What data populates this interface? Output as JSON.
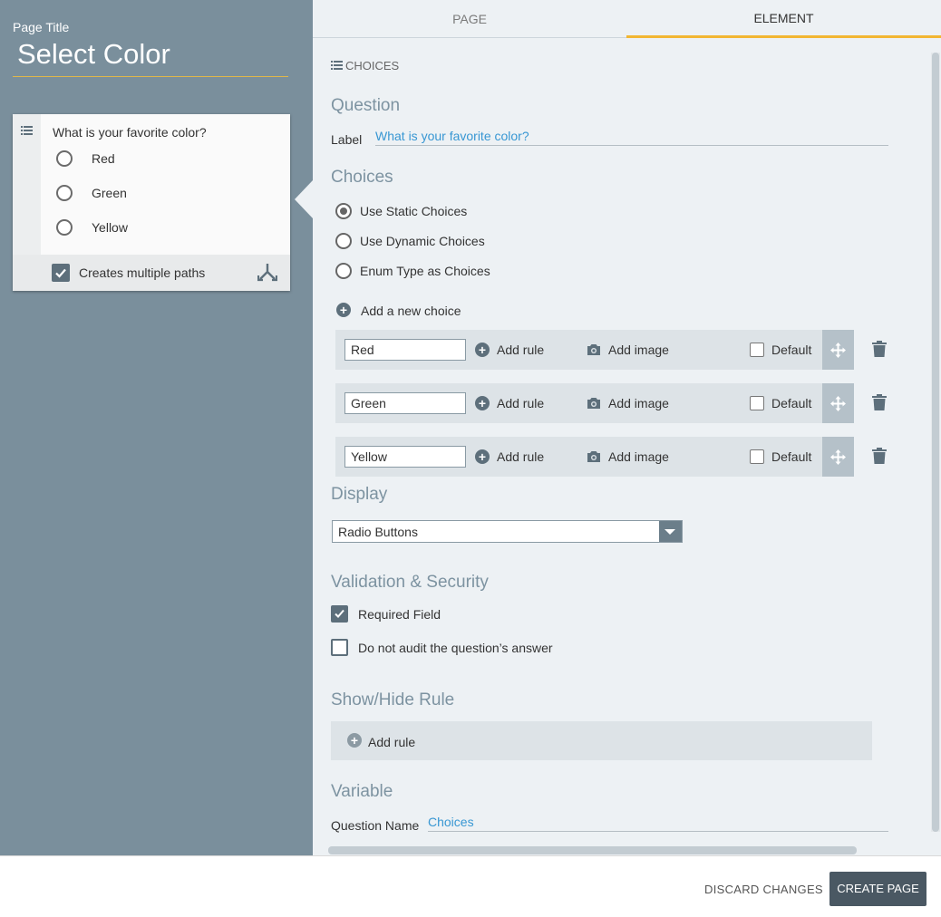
{
  "left_panel": {
    "page_title_label": "Page Title",
    "page_title_value": "Select Color",
    "question_card": {
      "question": "What is your favorite color?",
      "options": [
        "Red",
        "Green",
        "Yellow"
      ],
      "footer_label": "Creates multiple paths",
      "footer_checked": true
    }
  },
  "tabs": {
    "page": "PAGE",
    "element": "ELEMENT",
    "active": "ELEMENT"
  },
  "element": {
    "header": "CHOICES",
    "question_section": {
      "title": "Question",
      "label_caption": "Label",
      "label_value": "What is your favorite color?"
    },
    "choices_section": {
      "title": "Choices",
      "source_options": [
        "Use Static Choices",
        "Use Dynamic Choices",
        "Enum Type as Choices"
      ],
      "selected_source": "Use Static Choices",
      "add_choice": "Add a new choice",
      "rows": [
        {
          "value": "Red",
          "add_rule": "Add rule",
          "add_image": "Add image",
          "default": "Default"
        },
        {
          "value": "Green",
          "add_rule": "Add rule",
          "add_image": "Add image",
          "default": "Default"
        },
        {
          "value": "Yellow",
          "add_rule": "Add rule",
          "add_image": "Add image",
          "default": "Default"
        }
      ]
    },
    "display_section": {
      "title": "Display",
      "selected": "Radio Buttons"
    },
    "validation_section": {
      "title": "Validation & Security",
      "required": {
        "label": "Required Field",
        "checked": true
      },
      "no_audit": {
        "label": "Do not audit the question’s answer",
        "checked": false
      }
    },
    "rule_section": {
      "title": "Show/Hide Rule",
      "add_rule": "Add rule"
    },
    "variable_section": {
      "title": "Variable",
      "caption": "Question Name",
      "value": "Choices"
    }
  },
  "footer": {
    "discard": "DISCARD CHANGES",
    "create": "CREATE PAGE"
  },
  "colors": {
    "accent": "#f2b632",
    "link": "#3897d3",
    "sidebar": "#7a8f9c",
    "primary_button": "#4a5863"
  }
}
